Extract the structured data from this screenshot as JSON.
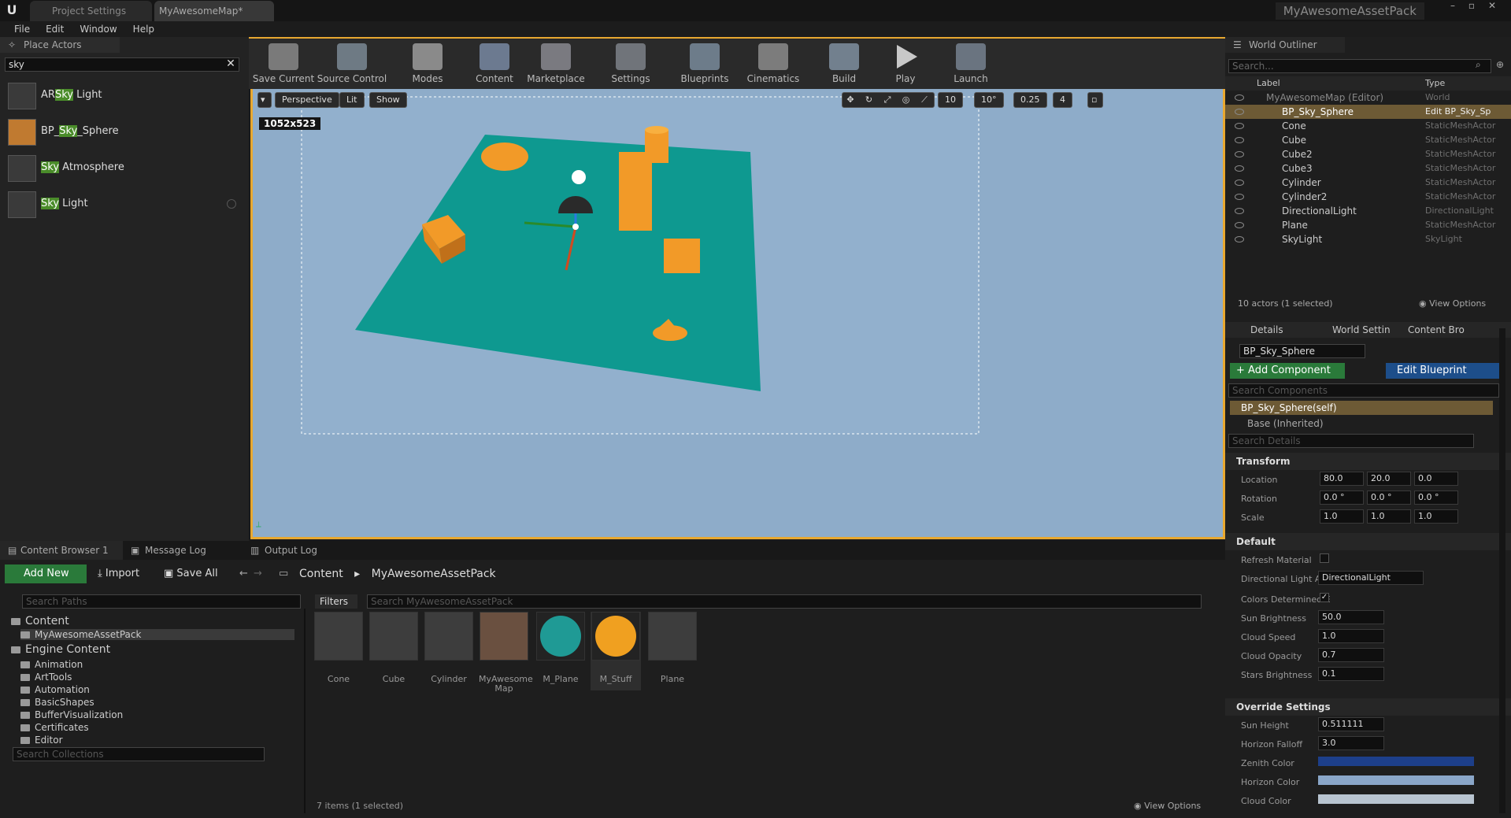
{
  "titlebar": {
    "tabs": [
      {
        "label": "Project Settings"
      },
      {
        "label": "MyAwesomeMap*"
      }
    ],
    "app_title": "MyAwesomeAssetPack"
  },
  "menu": [
    "File",
    "Edit",
    "Window",
    "Help"
  ],
  "place_actors": {
    "tab_label": "Place Actors",
    "search_value": "sky",
    "items": [
      {
        "pre": "AR",
        "hl": "Sky",
        "post": " Light"
      },
      {
        "pre": "BP_",
        "hl": "Sky",
        "post": "_Sphere"
      },
      {
        "pre": "",
        "hl": "Sky",
        "post": " Atmosphere"
      },
      {
        "pre": "",
        "hl": "Sky",
        "post": " Light"
      }
    ]
  },
  "toolbar": {
    "buttons": [
      "Save Current",
      "Source Control",
      "Modes",
      "Content",
      "Marketplace",
      "Settings",
      "Blueprints",
      "Cinematics",
      "Build",
      "Play",
      "Launch"
    ]
  },
  "viewport": {
    "perspective_label": "Perspective",
    "lit_label": "Lit",
    "show_label": "Show",
    "grid_snap": "10",
    "rotation_snap": "10°",
    "scale_snap": "0.25",
    "camera_speed": "4",
    "resolution": "1052x523"
  },
  "outliner": {
    "tab_label": "World Outliner",
    "search_placeholder": "Search...",
    "col_label": "Label",
    "col_type": "Type",
    "rows": [
      {
        "label": "MyAwesomeMap (Editor)",
        "type": "World"
      },
      {
        "label": "BP_Sky_Sphere",
        "type": "Edit BP_Sky_Sp"
      },
      {
        "label": "Cone",
        "type": "StaticMeshActor"
      },
      {
        "label": "Cube",
        "type": "StaticMeshActor"
      },
      {
        "label": "Cube2",
        "type": "StaticMeshActor"
      },
      {
        "label": "Cube3",
        "type": "StaticMeshActor"
      },
      {
        "label": "Cylinder",
        "type": "StaticMeshActor"
      },
      {
        "label": "Cylinder2",
        "type": "StaticMeshActor"
      },
      {
        "label": "DirectionalLight",
        "type": "DirectionalLight"
      },
      {
        "label": "Plane",
        "type": "StaticMeshActor"
      },
      {
        "label": "SkyLight",
        "type": "SkyLight"
      }
    ],
    "status": "10 actors (1 selected)",
    "view_options": "View Options"
  },
  "details": {
    "tabs": [
      "Details",
      "World Settin",
      "Content Bro"
    ],
    "actor_name": "BP_Sky_Sphere",
    "add_component": "+ Add Component",
    "edit_blueprint": "Edit Blueprint",
    "search_components": "Search Components",
    "self_component": "BP_Sky_Sphere(self)",
    "base_inherited": "Base (Inherited)",
    "search_details": "Search Details",
    "transform": {
      "title": "Transform",
      "location_label": "Location",
      "location": [
        "80.0",
        "20.0",
        "0.0"
      ],
      "rotation_label": "Rotation",
      "rotation": [
        "0.0 °",
        "0.0 °",
        "0.0 °"
      ],
      "scale_label": "Scale",
      "scale": [
        "1.0",
        "1.0",
        "1.0"
      ]
    },
    "default": {
      "title": "Default",
      "refresh_material": "Refresh Material",
      "directional_light_label": "Directional Light Act",
      "directional_light_value": "DirectionalLight",
      "colors_determined": "Colors Determined E",
      "sun_brightness_label": "Sun Brightness",
      "sun_brightness": "50.0",
      "cloud_speed_label": "Cloud Speed",
      "cloud_speed": "1.0",
      "cloud_opacity_label": "Cloud Opacity",
      "cloud_opacity": "0.7",
      "stars_brightness_label": "Stars Brightness",
      "stars_brightness": "0.1"
    },
    "override": {
      "title": "Override Settings",
      "sun_height_label": "Sun Height",
      "sun_height": "0.511111",
      "horizon_falloff_label": "Horizon Falloff",
      "horizon_falloff": "3.0",
      "zenith_color_label": "Zenith Color",
      "zenith_color": "#1d3f8a",
      "horizon_color_label": "Horizon Color",
      "horizon_color": "#8aa6c8",
      "cloud_color_label": "Cloud Color",
      "cloud_color": "#b8c4d0"
    }
  },
  "content_browser": {
    "tabs": [
      "Content Browser 1",
      "Message Log",
      "Output Log"
    ],
    "add_new": "Add New",
    "import": "Import",
    "save_all": "Save All",
    "path": [
      "Content",
      "MyAwesomeAssetPack"
    ],
    "search_paths": "Search Paths",
    "filters": "Filters",
    "search_assets": "Search MyAwesomeAssetPack",
    "tree": {
      "content": "Content",
      "project_folder": "MyAwesomeAssetPack",
      "engine": "Engine Content",
      "engine_folders": [
        "Animation",
        "ArtTools",
        "Automation",
        "BasicShapes",
        "BufferVisualization",
        "Certificates",
        "Editor"
      ]
    },
    "search_collections": "Search Collections",
    "assets": [
      {
        "label": "Cone",
        "color": "#5a6a7a"
      },
      {
        "label": "Cube",
        "color": "#4f5a64"
      },
      {
        "label": "Cylinder",
        "color": "#55606a"
      },
      {
        "label": "MyAwesome Map",
        "color": "#6a5040"
      },
      {
        "label": "M_Plane",
        "color": "#1f9a95"
      },
      {
        "label": "M_Stuff",
        "color": "#f0a020"
      },
      {
        "label": "Plane",
        "color": "#5f6e78"
      }
    ],
    "status": "7 items (1 selected)",
    "view_options": "View Options"
  }
}
